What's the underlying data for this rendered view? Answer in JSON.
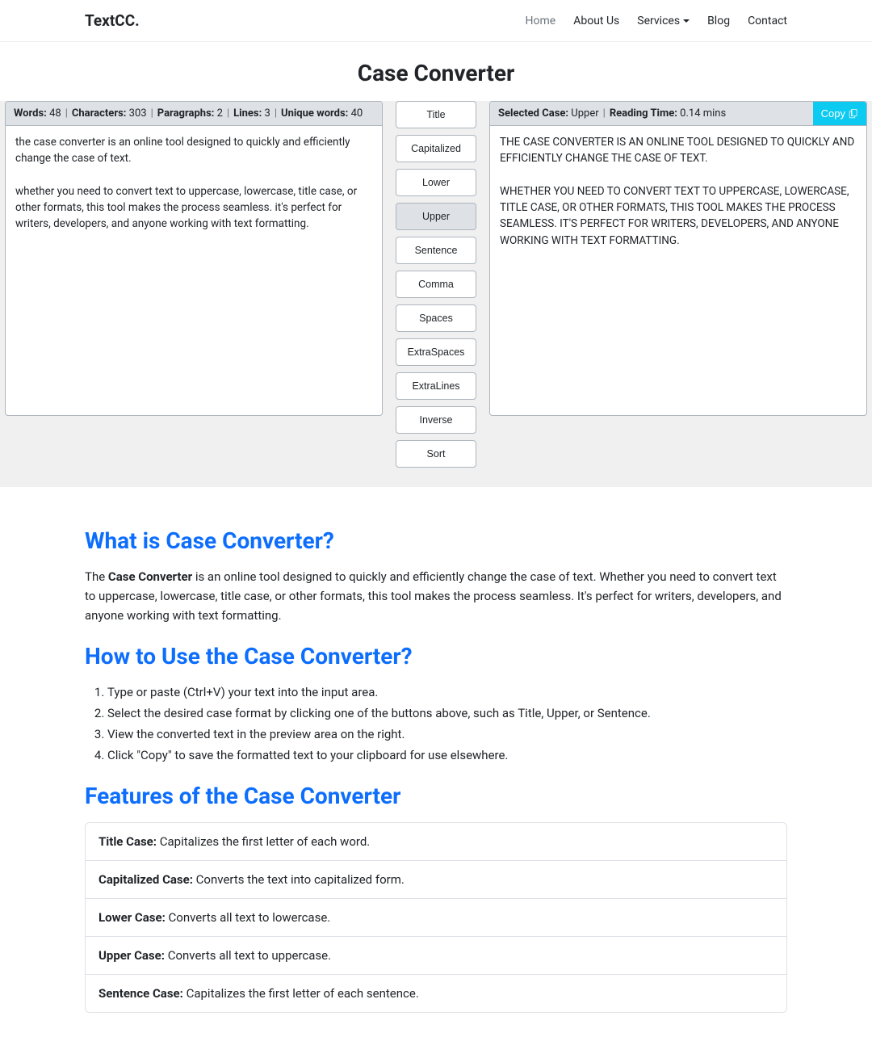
{
  "nav": {
    "brand": "TextCC.",
    "links": [
      "Home",
      "About Us",
      "Services",
      "Blog",
      "Contact"
    ]
  },
  "title": "Case Converter",
  "stats": {
    "words_label": "Words:",
    "words": "48",
    "chars_label": "Characters:",
    "chars": "303",
    "paras_label": "Paragraphs:",
    "paras": "2",
    "lines_label": "Lines:",
    "lines": "3",
    "unique_label": "Unique words:",
    "unique": "40"
  },
  "input_text": "the case converter is an online tool designed to quickly and efficiently change the case of text.\n\nwhether you need to convert text to uppercase, lowercase, title case, or other formats, this tool makes the process seamless. it's perfect for writers, developers, and anyone working with text formatting.",
  "buttons": [
    "Title",
    "Capitalized",
    "Lower",
    "Upper",
    "Sentence",
    "Comma",
    "Spaces",
    "ExtraSpaces",
    "ExtraLines",
    "Inverse",
    "Sort"
  ],
  "active_button_index": 3,
  "output_header": {
    "selected_label": "Selected Case:",
    "selected": "Upper",
    "reading_label": "Reading Time:",
    "reading": "0.14 mins",
    "copy": "Copy"
  },
  "output_text": "THE CASE CONVERTER IS AN ONLINE TOOL DESIGNED TO QUICKLY AND EFFICIENTLY CHANGE THE CASE OF TEXT.\n\nWHETHER YOU NEED TO CONVERT TEXT TO UPPERCASE, LOWERCASE, TITLE CASE, OR OTHER FORMATS, THIS TOOL MAKES THE PROCESS SEAMLESS. IT'S PERFECT FOR WRITERS, DEVELOPERS, AND ANYONE WORKING WITH TEXT FORMATTING.",
  "info": {
    "h1": "What is Case Converter?",
    "p1_pre": "The ",
    "p1_bold": "Case Converter",
    "p1_post": " is an online tool designed to quickly and efficiently change the case of text. Whether you need to convert text to uppercase, lowercase, title case, or other formats, this tool makes the process seamless. It's perfect for writers, developers, and anyone working with text formatting.",
    "h2": "How to Use the Case Converter?",
    "steps": [
      "Type or paste (Ctrl+V) your text into the input area.",
      "Select the desired case format by clicking one of the buttons above, such as Title, Upper, or Sentence.",
      "View the converted text in the preview area on the right.",
      "Click \"Copy\" to save the formatted text to your clipboard for use elsewhere."
    ],
    "h3": "Features of the Case Converter",
    "features": [
      {
        "b": "Title Case:",
        "t": " Capitalizes the first letter of each word."
      },
      {
        "b": "Capitalized Case:",
        "t": " Converts the text into capitalized form."
      },
      {
        "b": "Lower Case:",
        "t": " Converts all text to lowercase."
      },
      {
        "b": "Upper Case:",
        "t": " Converts all text to uppercase."
      },
      {
        "b": "Sentence Case:",
        "t": " Capitalizes the first letter of each sentence."
      }
    ]
  }
}
